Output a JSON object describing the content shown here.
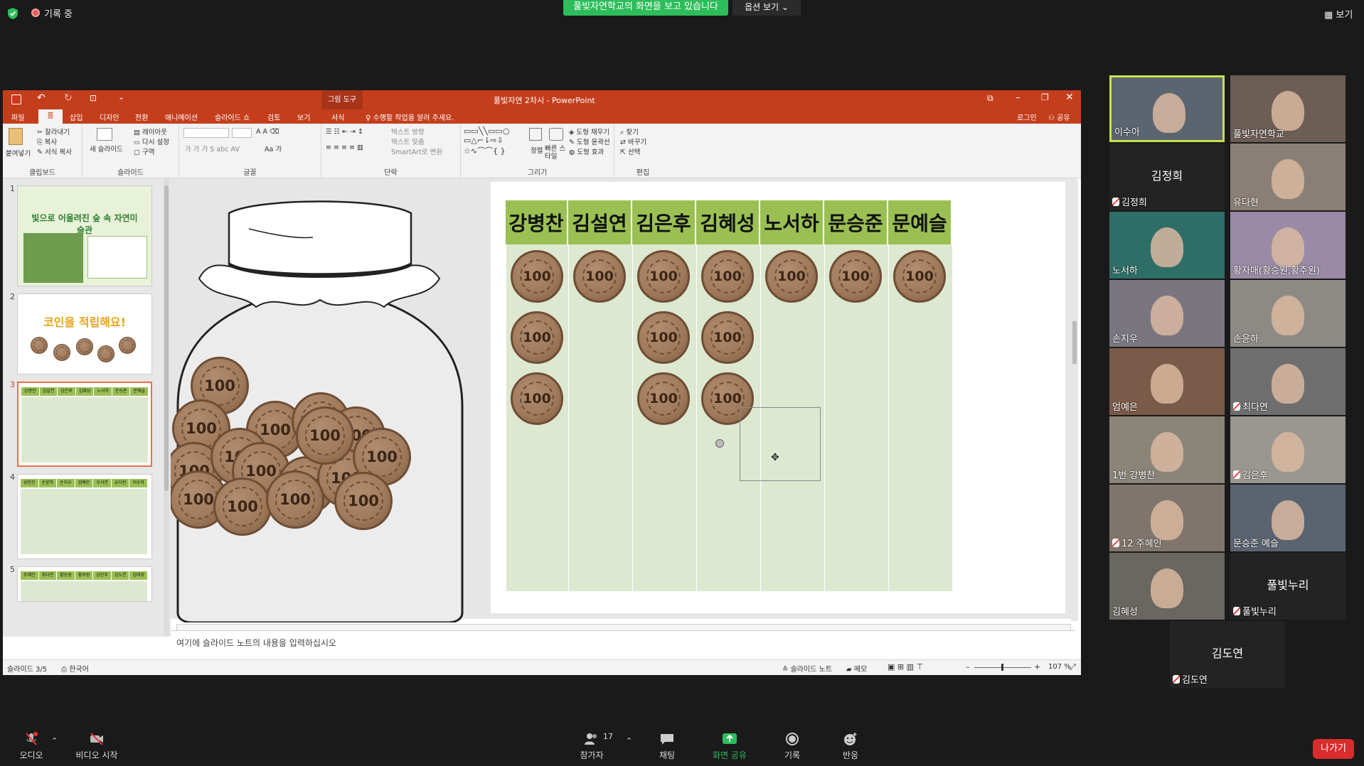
{
  "zoom": {
    "recording": "기록 중",
    "share_banner": "풀빛자연학교의 화면을 보고 있습니다",
    "view_options": "옵션 보기 ⌄",
    "view": "보기",
    "toolbar": {
      "audio": "오디오",
      "video": "비디오 시작",
      "participants": "참가자",
      "participant_count": "17",
      "chat": "채팅",
      "share": "화면 공유",
      "record": "기록",
      "reactions": "반응",
      "leave": "나가기"
    }
  },
  "ppt": {
    "context_tab": "그림 도구",
    "title": "풀빛자연 2차시 - PowerPoint",
    "tabs": [
      "파일",
      "홈",
      "삽입",
      "디자인",
      "전환",
      "애니메이션",
      "슬라이드 쇼",
      "검토",
      "보기",
      "서식"
    ],
    "tell_me": "수행할 작업을 알려 주세요.",
    "login": "로그인",
    "share": "공유",
    "ribbon": {
      "clipboard": {
        "label": "클립보드",
        "paste": "붙여넣기",
        "cut": "잘라내기",
        "copy": "복사",
        "format_painter": "서식 복사"
      },
      "slides": {
        "label": "슬라이드",
        "new_slide": "새 슬라이드",
        "layout": "레이아웃",
        "reset": "다시 설정",
        "section": "구역"
      },
      "font": {
        "label": "글꼴"
      },
      "paragraph": {
        "label": "단락",
        "text_dir": "텍스트 방향",
        "align_text": "텍스트 맞춤",
        "smartart": "SmartArt로 변환"
      },
      "drawing": {
        "label": "그리기",
        "arrange": "정렬",
        "quick_styles": "빠른 스타일",
        "fill": "도형 채우기",
        "outline": "도형 윤곽선",
        "effects": "도형 효과"
      },
      "editing": {
        "label": "편집",
        "find": "찾기",
        "replace": "바꾸기",
        "select": "선택"
      }
    },
    "slides_panel": {
      "numbers": [
        "1",
        "2",
        "3",
        "4",
        "5"
      ],
      "thumb1_title": "빛으로 어울려진 숲 속 자연미술관",
      "thumb2_title": "코인을 적립해요!",
      "thumb3_names": [
        "강병찬",
        "김설연",
        "김은후",
        "김혜성",
        "노서하",
        "문승준",
        "문예슬"
      ],
      "thumb4_names": [
        "성민진",
        "손윤하",
        "손지우",
        "엄예은",
        "우서연",
        "유다현",
        "이수아"
      ],
      "thumb5_names": [
        "주혜인",
        "최다연",
        "황승원",
        "황주원",
        "김민주",
        "김도연",
        "김태희"
      ]
    },
    "slide": {
      "names": [
        "강병찬",
        "김설연",
        "김은후",
        "김혜성",
        "노서하",
        "문승준",
        "문예슬"
      ],
      "coin_counts": [
        3,
        1,
        3,
        3,
        1,
        1,
        1
      ],
      "coin_label": "100"
    },
    "notes_placeholder": "여기에 슬라이드 노트의 내용을 입력하십시오",
    "status": {
      "slide": "슬라이드 3/5",
      "lang": "한국어",
      "notes": "슬라이드 노트",
      "comments": "메모",
      "zoom": "107 %"
    }
  },
  "participants": [
    {
      "name": "이수아",
      "type": "video",
      "muted": false
    },
    {
      "name": "풀빛자연학교",
      "type": "video",
      "muted": false
    },
    {
      "name": "김정희",
      "type": "name",
      "muted": true
    },
    {
      "name": "유다현",
      "type": "video",
      "muted": false
    },
    {
      "name": "노서하",
      "type": "video",
      "muted": false
    },
    {
      "name": "황자매(황승원,황주원)",
      "type": "video",
      "muted": false
    },
    {
      "name": "손지우",
      "type": "video",
      "muted": false
    },
    {
      "name": "손윤하",
      "type": "video",
      "muted": false
    },
    {
      "name": "엄예은",
      "type": "video",
      "muted": false
    },
    {
      "name": "최다연",
      "type": "video",
      "muted": true
    },
    {
      "name": "1번 강병찬",
      "type": "video",
      "muted": false
    },
    {
      "name": "김은후",
      "type": "video",
      "muted": true
    },
    {
      "name": "12 주혜인",
      "type": "video",
      "muted": true
    },
    {
      "name": "문승준 예슬",
      "type": "video",
      "muted": false
    },
    {
      "name": "김혜성",
      "type": "video",
      "muted": false
    },
    {
      "name": "풀빛누리",
      "type": "name",
      "muted": true
    },
    {
      "name": "김도연",
      "type": "name",
      "muted": true
    }
  ],
  "colors": {
    "ppt_accent": "#c43e1c",
    "header_green": "#9ac053",
    "column_bg": "#dde8d1",
    "zoom_green": "#2dbd5a",
    "leave_red": "#d92c2c"
  }
}
